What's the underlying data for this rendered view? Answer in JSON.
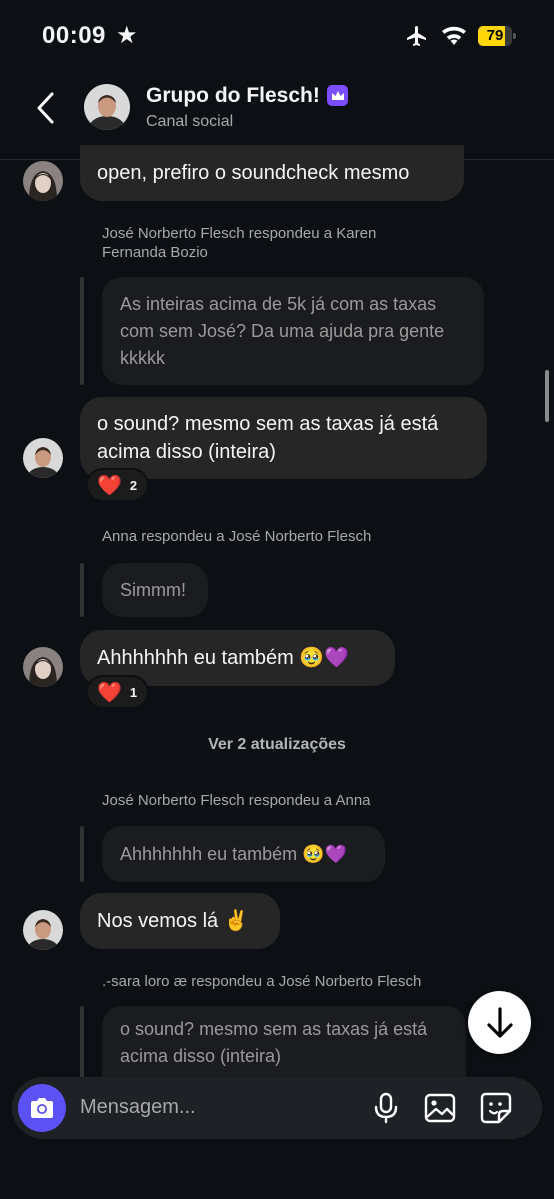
{
  "status_bar": {
    "time": "00:09",
    "battery": "79",
    "battery_level": 0.79
  },
  "header": {
    "title": "Grupo do Flesch!",
    "subtitle": "Canal social"
  },
  "messages": {
    "m1_text": "open, prefiro o soundcheck mesmo",
    "r1_label": "José Norberto Flesch respondeu a Karen Fernanda Bozio",
    "r1_quote": "As inteiras acima de 5k já com as taxas com sem José? Da uma ajuda pra gente kkkkk",
    "r1_text": "o sound? mesmo sem as taxas já está acima disso (inteira)",
    "r1_reaction_count": "2",
    "r2_label": "Anna respondeu a José Norberto Flesch",
    "r2_quote": "Simmm!",
    "r2_text": "Ahhhhhhh eu também 🥹💜",
    "r2_reaction_count": "1",
    "updates": "Ver 2 atualizações",
    "r3_label": "José Norberto Flesch respondeu a Anna",
    "r3_quote": "Ahhhhhhh eu também 🥹💜",
    "r3_text": "Nos vemos lá ✌️",
    "r4_label": ".-sara loro æ respondeu a José Norberto Flesch",
    "r4_quote": "o sound? mesmo sem as taxas já está acima disso (inteira)"
  },
  "composer": {
    "placeholder": "Mensagem..."
  },
  "colors": {
    "background": "#0c1014",
    "bubble": "#262626",
    "accent": "#5b51f5",
    "battery": "#ffd60a"
  }
}
